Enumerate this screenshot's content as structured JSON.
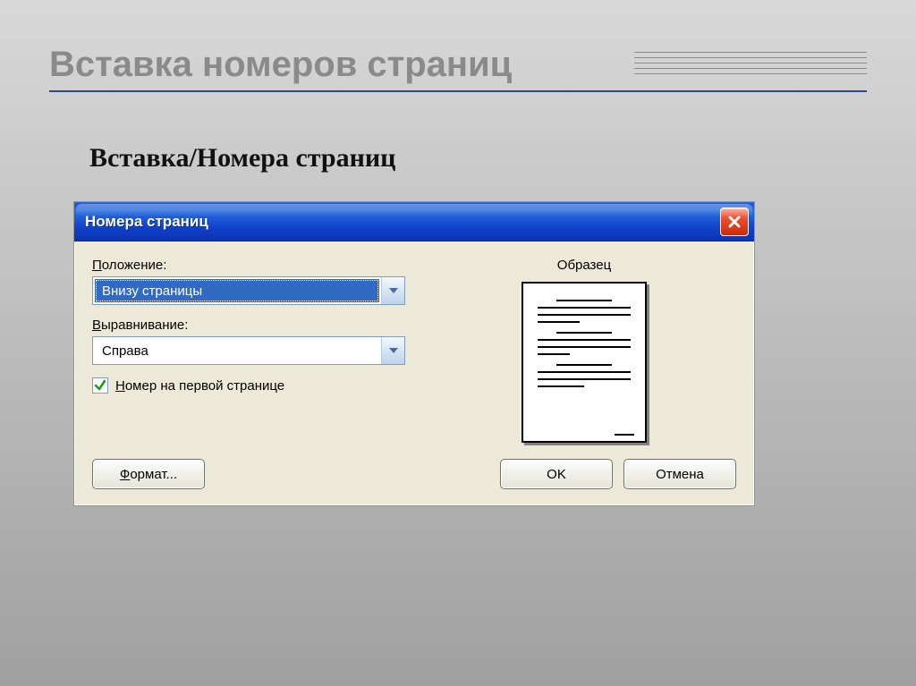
{
  "slide": {
    "title": "Вставка номеров страниц",
    "subheading": "Вставка/Номера страниц"
  },
  "dialog": {
    "title": "Номера страниц",
    "position_label": "Положение:",
    "position_value": "Внизу страницы",
    "align_label": "Выравнивание:",
    "align_value": "Справа",
    "firstpage_label": "Номер на первой странице",
    "firstpage_checked": true,
    "preview_label": "Образец",
    "format_btn": "Формат...",
    "ok_btn": "OK",
    "cancel_btn": "Отмена"
  }
}
